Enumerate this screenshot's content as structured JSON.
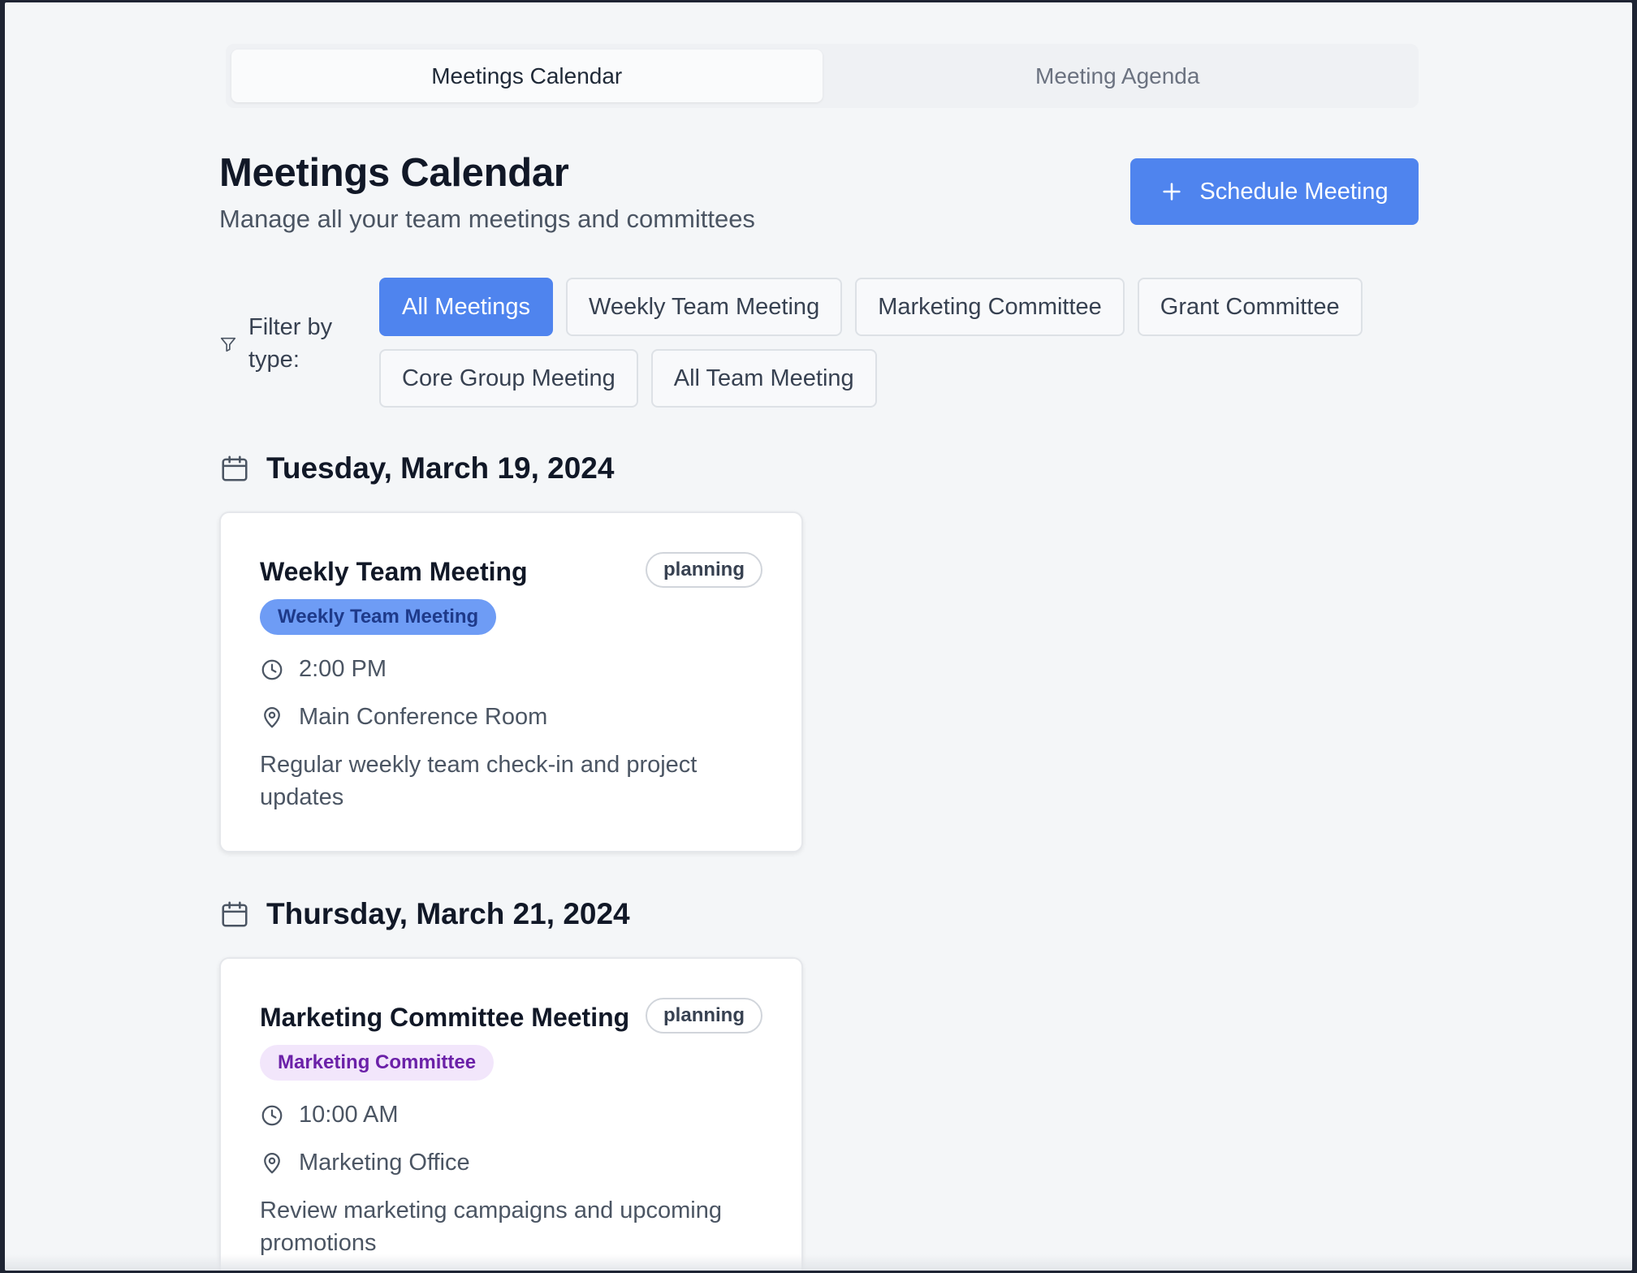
{
  "tabs": [
    {
      "label": "Meetings Calendar",
      "active": true
    },
    {
      "label": "Meeting Agenda",
      "active": false
    }
  ],
  "header": {
    "title": "Meetings Calendar",
    "subtitle": "Manage all your team meetings and committees",
    "schedule_button_label": "Schedule Meeting",
    "schedule_button_icon": "plus-icon"
  },
  "filters": {
    "label": "Filter by type:",
    "icon": "filter-icon",
    "options": [
      {
        "label": "All Meetings",
        "active": true
      },
      {
        "label": "Weekly Team Meeting",
        "active": false
      },
      {
        "label": "Marketing Committee",
        "active": false
      },
      {
        "label": "Grant Committee",
        "active": false
      },
      {
        "label": "Core Group Meeting",
        "active": false
      },
      {
        "label": "All Team Meeting",
        "active": false
      }
    ]
  },
  "days": [
    {
      "date": "Tuesday, March 19, 2024",
      "meetings": [
        {
          "title": "Weekly Team Meeting",
          "status": "planning",
          "type": "Weekly Team Meeting",
          "type_color": "blue",
          "time": "2:00 PM",
          "location": "Main Conference Room",
          "description": "Regular weekly team check-in and project updates"
        }
      ]
    },
    {
      "date": "Thursday, March 21, 2024",
      "meetings": [
        {
          "title": "Marketing Committee Meeting",
          "status": "planning",
          "type": "Marketing Committee",
          "type_color": "purple",
          "time": "10:00 AM",
          "location": "Marketing Office",
          "description": "Review marketing campaigns and upcoming promotions"
        }
      ]
    }
  ],
  "colors": {
    "accent": "#4f84ee",
    "background": "#f4f6f8",
    "weekly_badge_bg": "#6e9cf5",
    "marketing_badge_bg": "#f2e6fb"
  }
}
